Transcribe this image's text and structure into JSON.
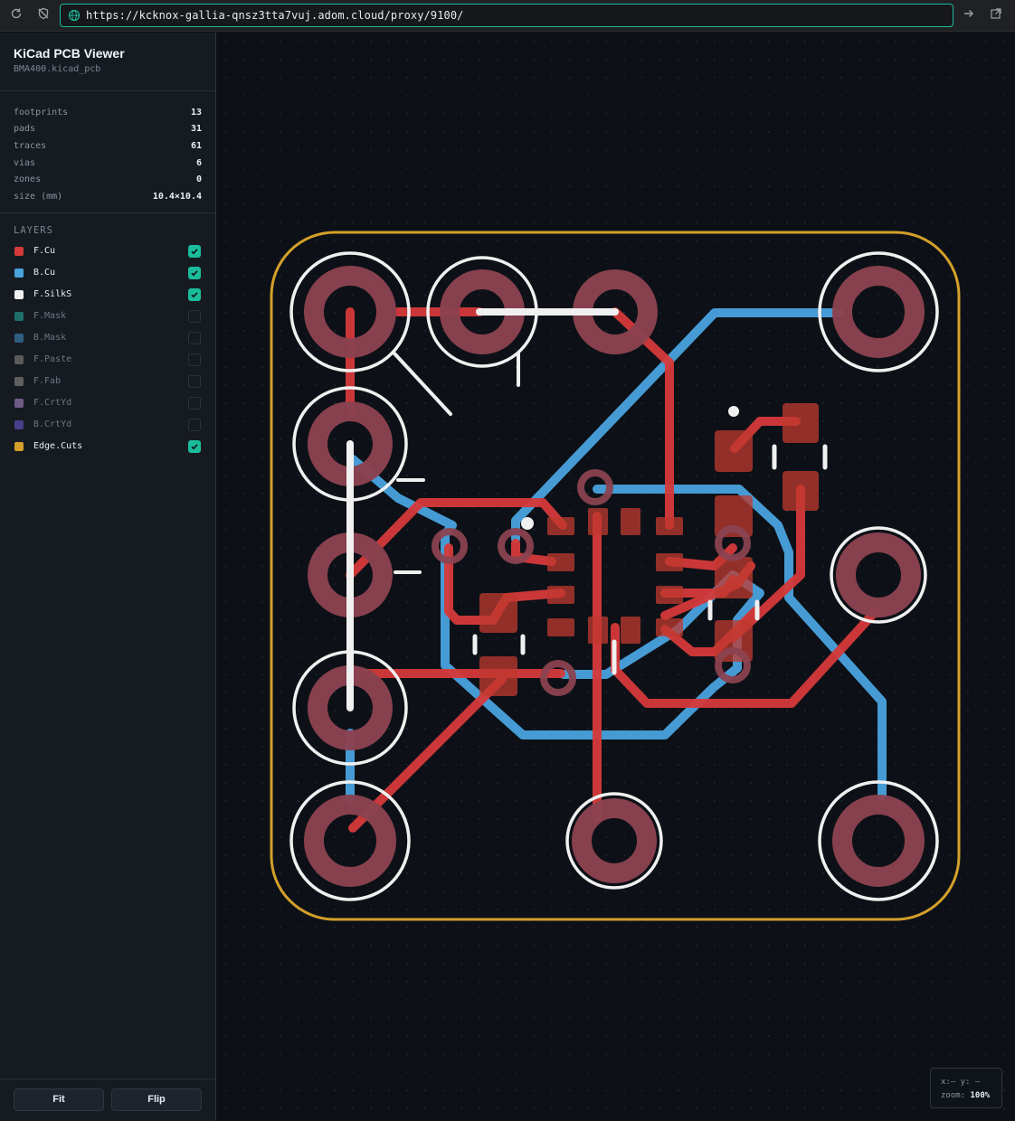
{
  "browser": {
    "url": "https://kcknox-gallia-qnsz3tta7vuj.adom.cloud/proxy/9100/",
    "icons": [
      "reload-icon",
      "shield-icon",
      "globe-icon",
      "forward-icon",
      "open-external-icon"
    ]
  },
  "app": {
    "title": "KiCad PCB Viewer",
    "file": "BMA400.kicad_pcb"
  },
  "stats": [
    {
      "label": "footprints",
      "value": "13"
    },
    {
      "label": "pads",
      "value": "31"
    },
    {
      "label": "traces",
      "value": "61"
    },
    {
      "label": "vias",
      "value": "6"
    },
    {
      "label": "zones",
      "value": "0"
    },
    {
      "label": "size (mm)",
      "value": "10.4×10.4"
    }
  ],
  "layers_title": "LAYERS",
  "layers": [
    {
      "name": "F.Cu",
      "color": "#d63a3a",
      "visible": true
    },
    {
      "name": "B.Cu",
      "color": "#4aa3df",
      "visible": true
    },
    {
      "name": "F.SilkS",
      "color": "#f0f0f0",
      "visible": true
    },
    {
      "name": "F.Mask",
      "color": "#1f6f6a",
      "visible": false
    },
    {
      "name": "B.Mask",
      "color": "#2f5f80",
      "visible": false
    },
    {
      "name": "F.Paste",
      "color": "#5a5a5a",
      "visible": false
    },
    {
      "name": "F.Fab",
      "color": "#5e5e5e",
      "visible": false
    },
    {
      "name": "F.CrtYd",
      "color": "#6e5a86",
      "visible": false
    },
    {
      "name": "B.CrtYd",
      "color": "#4a3f8a",
      "visible": false
    },
    {
      "name": "Edge.Cuts",
      "color": "#d4a02a",
      "visible": true
    }
  ],
  "buttons": {
    "fit": "Fit",
    "flip": "Flip"
  },
  "readout": {
    "coords_label": "x:— y: —",
    "zoom_label": "zoom:",
    "zoom_value": "100%"
  },
  "colors": {
    "accent": "#1abc9c",
    "front_copper": "#d63a3a",
    "back_copper": "#4aa3df",
    "silkscreen": "#f0f0f0",
    "edge_cuts": "#d4a02a",
    "pad": "#8b4250"
  }
}
